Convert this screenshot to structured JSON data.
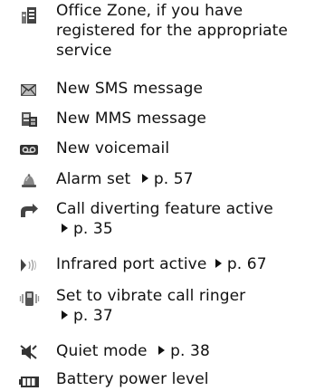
{
  "items": [
    {
      "icon": "office-zone-icon",
      "lines": [
        "Office Zone, if you have",
        "registered for the appropriate",
        "service"
      ]
    },
    {
      "icon": "envelope-icon",
      "lines": [
        "New SMS message"
      ]
    },
    {
      "icon": "mms-message-icon",
      "lines": [
        "New MMS message"
      ]
    },
    {
      "icon": "voicemail-icon",
      "lines": [
        "New voicemail"
      ]
    },
    {
      "icon": "alarm-bell-icon",
      "text": "Alarm set",
      "ref": "p. 57"
    },
    {
      "icon": "call-divert-icon",
      "text": "Call diverting feature active",
      "ref": "p. 35"
    },
    {
      "icon": "infrared-icon",
      "text": "Infrared port active",
      "ref": "p. 67"
    },
    {
      "icon": "vibrate-icon",
      "text": "Set to vibrate call ringer",
      "ref": "p. 37"
    },
    {
      "icon": "quiet-mode-icon",
      "text": "Quiet mode",
      "ref": "p. 38"
    },
    {
      "icon": "battery-icon",
      "lines": [
        "Battery power level"
      ]
    }
  ]
}
